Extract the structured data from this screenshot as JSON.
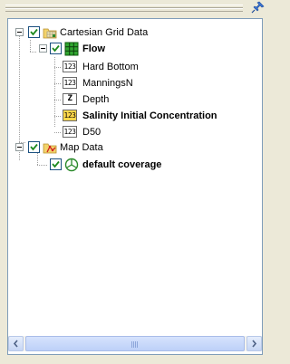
{
  "tree": {
    "items": [
      {
        "label": "Cartesian Grid Data",
        "checked": true,
        "icon": "grid-data-folder-icon",
        "bold": false
      },
      {
        "label": "Flow",
        "checked": true,
        "icon": "green-grid-icon",
        "bold": true
      },
      {
        "label": "Hard Bottom",
        "icon_text": "123",
        "bold": false
      },
      {
        "label": "ManningsN",
        "icon_text": "123",
        "bold": false
      },
      {
        "label": "Depth",
        "icon_text": "Z",
        "bold": false
      },
      {
        "label": "Salinity Initial Concentration",
        "icon_text": "123",
        "bold": true,
        "highlighted": true
      },
      {
        "label": "D50",
        "icon_text": "123",
        "bold": false
      },
      {
        "label": "Map Data",
        "checked": true,
        "icon": "map-data-folder-icon",
        "bold": false
      },
      {
        "label": "default coverage",
        "checked": true,
        "icon": "coverage-icon",
        "bold": true
      }
    ]
  },
  "colors": {
    "panel_bg": "#ece9d8",
    "tree_border": "#7f9db9",
    "highlight_bg": "#ffd84a",
    "checkbox_border": "#1c5180"
  }
}
